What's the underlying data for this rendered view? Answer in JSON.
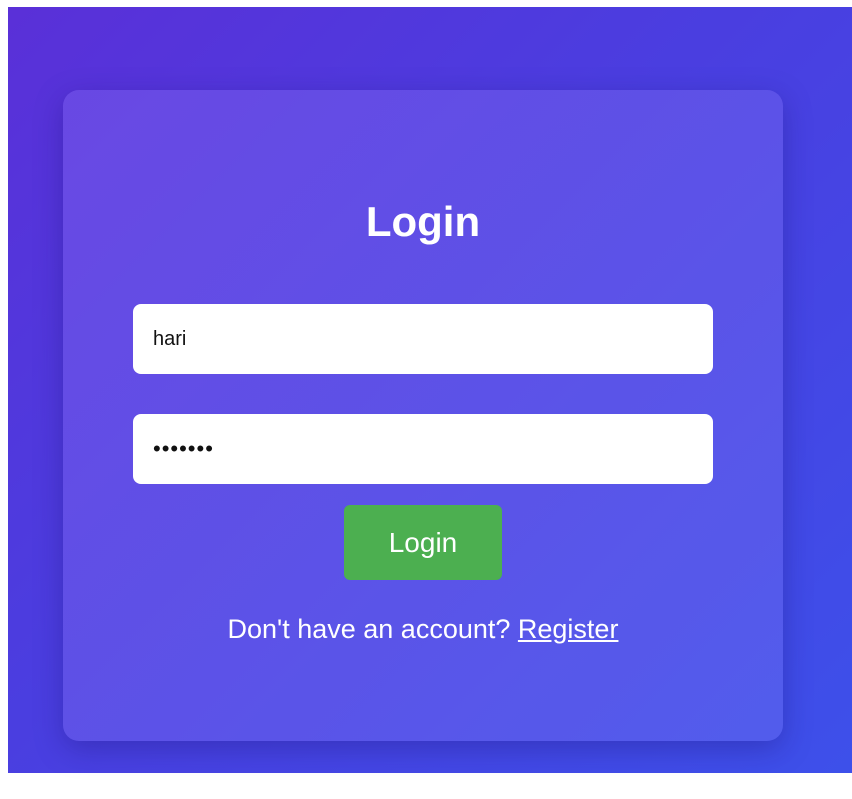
{
  "form": {
    "title": "Login",
    "username_value": "hari",
    "password_value": "•••••••",
    "submit_label": "Login",
    "register_prompt": "Don't have an account?",
    "register_link": "Register"
  },
  "colors": {
    "background_gradient_start": "#5a30d8",
    "background_gradient_end": "#3d50ea",
    "submit_button": "#4caf50",
    "text": "#ffffff"
  }
}
